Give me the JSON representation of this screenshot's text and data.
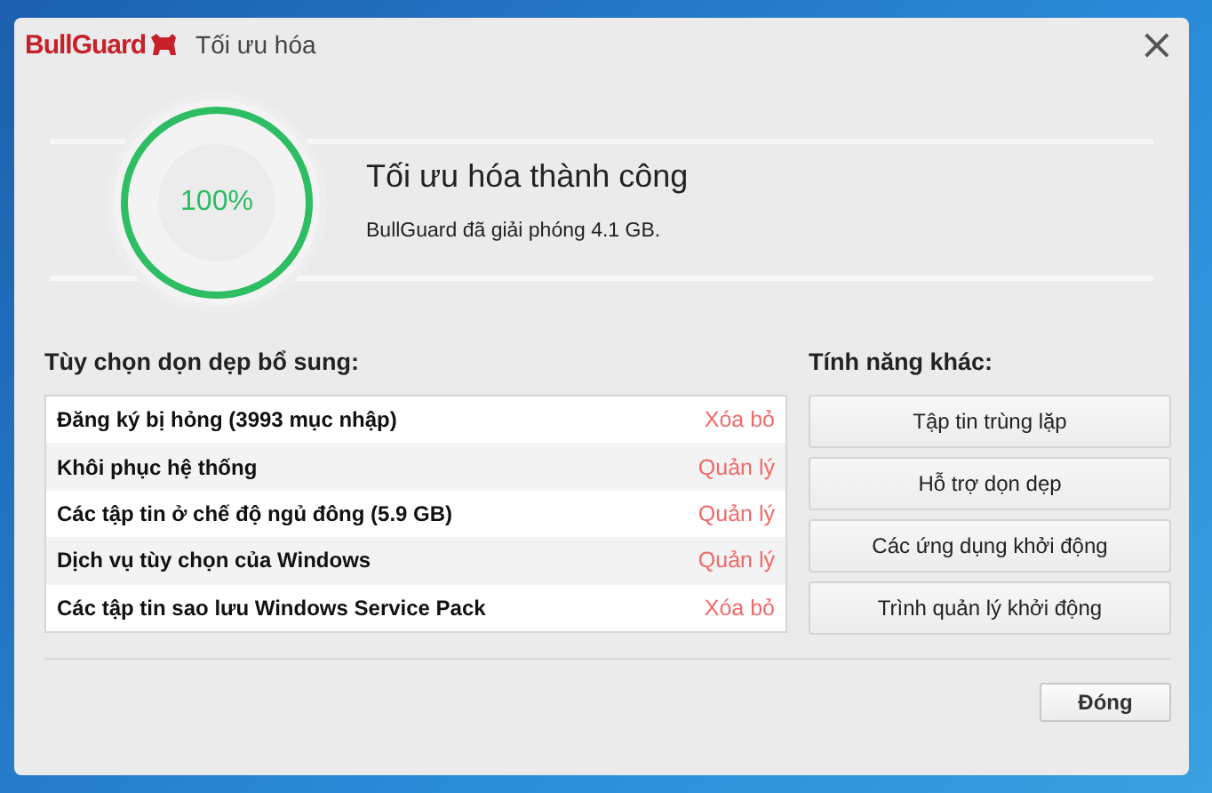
{
  "window": {
    "logo": "BullGuard",
    "title": "Tối ưu hóa",
    "close": "×"
  },
  "progress": {
    "level": 1,
    "percent": "100%",
    "heading": "Tối ưu hóa thành công",
    "message": "BullGuard đã giải phóng 4.1 GB."
  },
  "cleanup": {
    "heading": "Tùy chọn dọn dẹp bổ sung:",
    "rows": [
      {
        "label": "Đăng ký bị hỏng (3993 mục nhập)",
        "action": "Xóa bỏ"
      },
      {
        "label": "Khôi phục hệ thống",
        "action": "Quản lý"
      },
      {
        "label": "Các tập tin ở chế độ ngủ đông (5.9 GB)",
        "action": "Quản lý"
      },
      {
        "label": "Dịch vụ tùy chọn của Windows",
        "action": "Quản lý"
      },
      {
        "label": "Các tập tin sao lưu Windows Service Pack",
        "action": "Xóa bỏ"
      }
    ]
  },
  "features": {
    "heading": "Tính năng khác:",
    "buttons": [
      "Tập tin trùng lặp",
      "Hỗ trợ dọn dẹp",
      "Các ứng dụng khởi động",
      "Trình quản lý khởi động"
    ]
  },
  "footer": {
    "close_button": "Đóng"
  }
}
